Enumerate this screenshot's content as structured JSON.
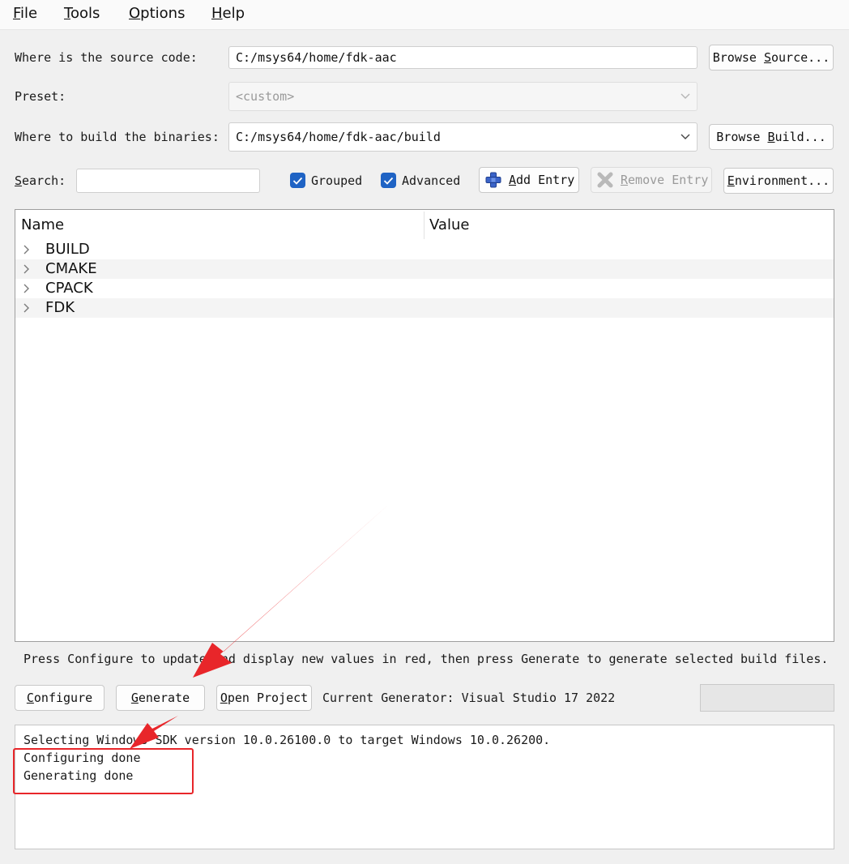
{
  "menu": {
    "items": [
      {
        "mnemonic": "F",
        "rest": "ile"
      },
      {
        "mnemonic": "T",
        "rest": "ools"
      },
      {
        "mnemonic": "O",
        "rest": "ptions"
      },
      {
        "mnemonic": "H",
        "rest": "elp"
      }
    ]
  },
  "source": {
    "label": "Where is the source code:",
    "value": "C:/msys64/home/fdk-aac",
    "browse_pre": "Browse ",
    "browse_mn": "S",
    "browse_post": "ource..."
  },
  "preset": {
    "label": "Preset:",
    "value": "<custom>"
  },
  "build": {
    "label": "Where to build the binaries:",
    "value": "C:/msys64/home/fdk-aac/build",
    "browse_pre": "Browse ",
    "browse_mn": "B",
    "browse_post": "uild..."
  },
  "search": {
    "label_mn": "S",
    "label_rest": "earch:",
    "value": ""
  },
  "options": {
    "grouped": {
      "label": "Grouped",
      "checked": true
    },
    "advanced": {
      "label": "Advanced",
      "checked": true
    }
  },
  "toolbar": {
    "add_entry_mn": "A",
    "add_entry_rest": "dd Entry",
    "remove_entry_mn": "R",
    "remove_entry_rest": "emove Entry",
    "environment_mn": "E",
    "environment_rest": "nvironment..."
  },
  "tree": {
    "columns": [
      "Name",
      "Value"
    ],
    "rows": [
      {
        "name": "BUILD",
        "value": ""
      },
      {
        "name": "CMAKE",
        "value": ""
      },
      {
        "name": "CPACK",
        "value": ""
      },
      {
        "name": "FDK",
        "value": ""
      }
    ]
  },
  "hint": "Press Configure to update and display new values in red, then press Generate to generate selected build files.",
  "actions": {
    "configure_mn": "C",
    "configure_rest": "onfigure",
    "generate_mn": "G",
    "generate_rest": "enerate",
    "open_project_mn": "O",
    "open_project_rest": "pen Project",
    "current_generator": "Current Generator: Visual Studio 17 2022"
  },
  "output": {
    "lines": [
      "Selecting Windows SDK version 10.0.26100.0 to target Windows 10.0.26200.",
      "Configuring done",
      "Generating done"
    ]
  },
  "colors": {
    "accent": "#1f63c4",
    "annotation": "#e8262a"
  },
  "icons": {
    "add": "plus-icon",
    "remove": "x-icon",
    "expand": "chevron-right-icon",
    "dropdown": "chevron-down-icon",
    "check": "checkmark-icon"
  }
}
